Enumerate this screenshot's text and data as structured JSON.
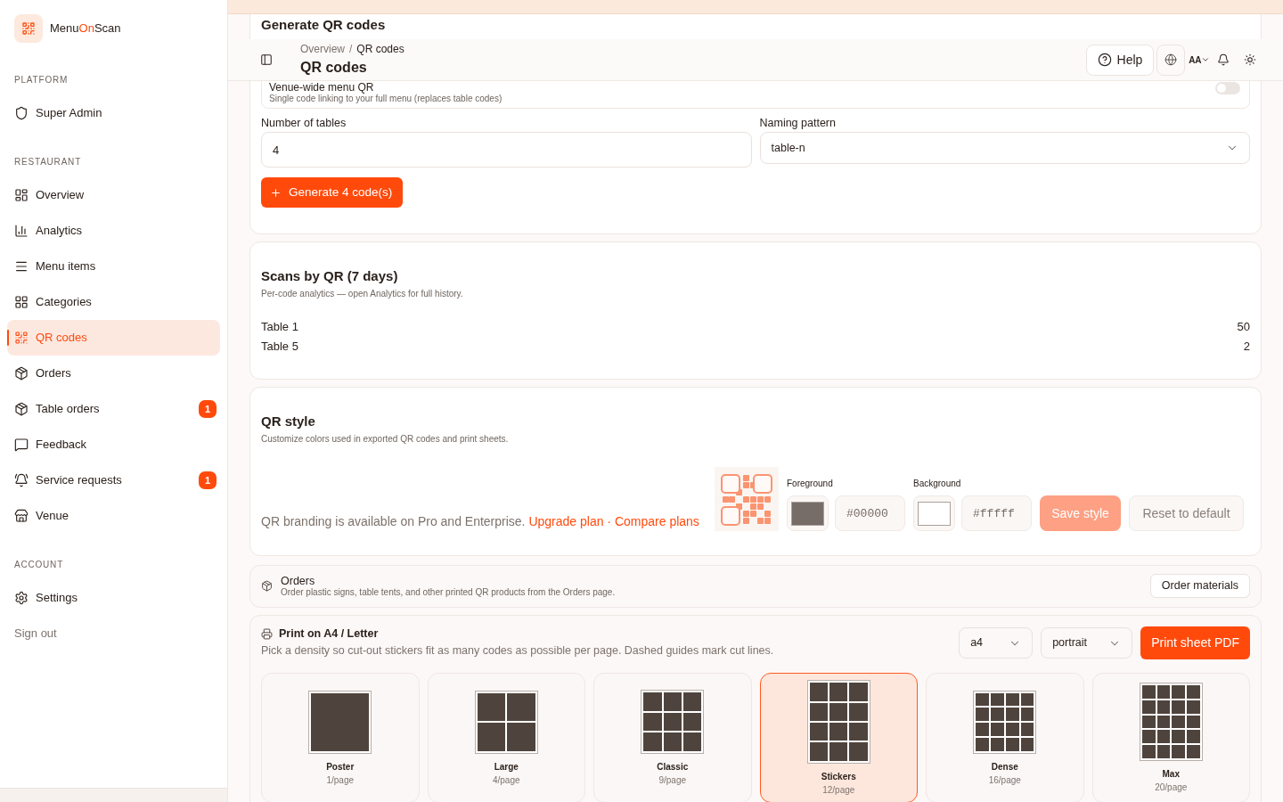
{
  "sidebar": {
    "brand": [
      {
        "text": "Menu",
        "accent": false
      },
      {
        "text": "On",
        "accent": true
      },
      {
        "text": "Scan",
        "accent": false
      }
    ],
    "sections": [
      {
        "title": "PLATFORM",
        "items": [
          {
            "label": "Super Admin",
            "selected": false
          }
        ]
      },
      {
        "title": "RESTAURANT",
        "items": [
          {
            "label": "Overview",
            "selected": false
          },
          {
            "label": "Analytics",
            "selected": false
          },
          {
            "label": "Menu items",
            "selected": false
          },
          {
            "label": "Categories",
            "selected": false
          },
          {
            "label": "QR codes",
            "selected": true
          },
          {
            "label": "Orders",
            "selected": false
          },
          {
            "label": "Table orders",
            "selected": false,
            "badge": "1"
          },
          {
            "label": "Feedback",
            "selected": false
          },
          {
            "label": "Service requests",
            "selected": false,
            "badge": "1"
          },
          {
            "label": "Venue",
            "selected": false
          }
        ]
      },
      {
        "title": "ACCOUNT",
        "items": [
          {
            "label": "Settings",
            "selected": false
          }
        ]
      }
    ],
    "sign_out": "Sign out"
  },
  "header": {
    "breadcrumb": [
      "Overview",
      "QR codes"
    ],
    "breadcrumb_separator": "/",
    "title": "QR codes",
    "help": "Help",
    "text_size": "AA"
  },
  "generate": {
    "title": "Generate QR codes",
    "venue_qr": {
      "title": "Venue-wide menu QR",
      "description": "Single code linking to your full menu (replaces table codes)",
      "on": false
    },
    "tables": {
      "label": "Number of tables",
      "value": "4"
    },
    "naming": {
      "label": "Naming pattern",
      "value": "table-n"
    },
    "button": "Generate 4 code(s)"
  },
  "scans": {
    "title": "Scans by QR (7 days)",
    "description": "Per-code analytics — open Analytics for full history.",
    "rows": [
      {
        "name": "Table 1",
        "count": "50"
      },
      {
        "name": "Table 5",
        "count": "2"
      }
    ]
  },
  "qr_style": {
    "title": "QR style",
    "description": "Customize colors used in exported QR codes and print sheets.",
    "notice": "QR branding is available on Pro and Enterprise.",
    "links": [
      "Upgrade plan",
      "Compare plans"
    ],
    "link_separator": "·",
    "disabled": true,
    "foreground": {
      "label": "Foreground",
      "color": "#766d68",
      "value": "#00000"
    },
    "background": {
      "label": "Background",
      "color": "#ffffff",
      "value": "#fffff"
    },
    "save": "Save style",
    "reset": "Reset to default"
  },
  "orders": {
    "title": "Orders",
    "description": "Order plastic signs, table tents, and other printed QR products from the Orders page.",
    "button": "Order materials"
  },
  "print": {
    "title": "Print on A4 / Letter",
    "description": "Pick a density so cut-out stickers fit as many codes as possible per page. Dashed guides mark cut lines.",
    "paper": "a4",
    "orientation": "portrait",
    "button": "Print sheet PDF",
    "densities": [
      {
        "kind": "poster",
        "name": "Poster",
        "per_page": "1/page",
        "selected": false
      },
      {
        "kind": "large",
        "name": "Large",
        "per_page": "4/page",
        "selected": false
      },
      {
        "kind": "classic",
        "name": "Classic",
        "per_page": "9/page",
        "selected": false
      },
      {
        "kind": "stickers",
        "name": "Stickers",
        "per_page": "12/page",
        "selected": true
      },
      {
        "kind": "dense",
        "name": "Dense",
        "per_page": "16/page",
        "selected": false
      },
      {
        "kind": "max",
        "name": "Max",
        "per_page": "20/page",
        "selected": false
      }
    ]
  }
}
